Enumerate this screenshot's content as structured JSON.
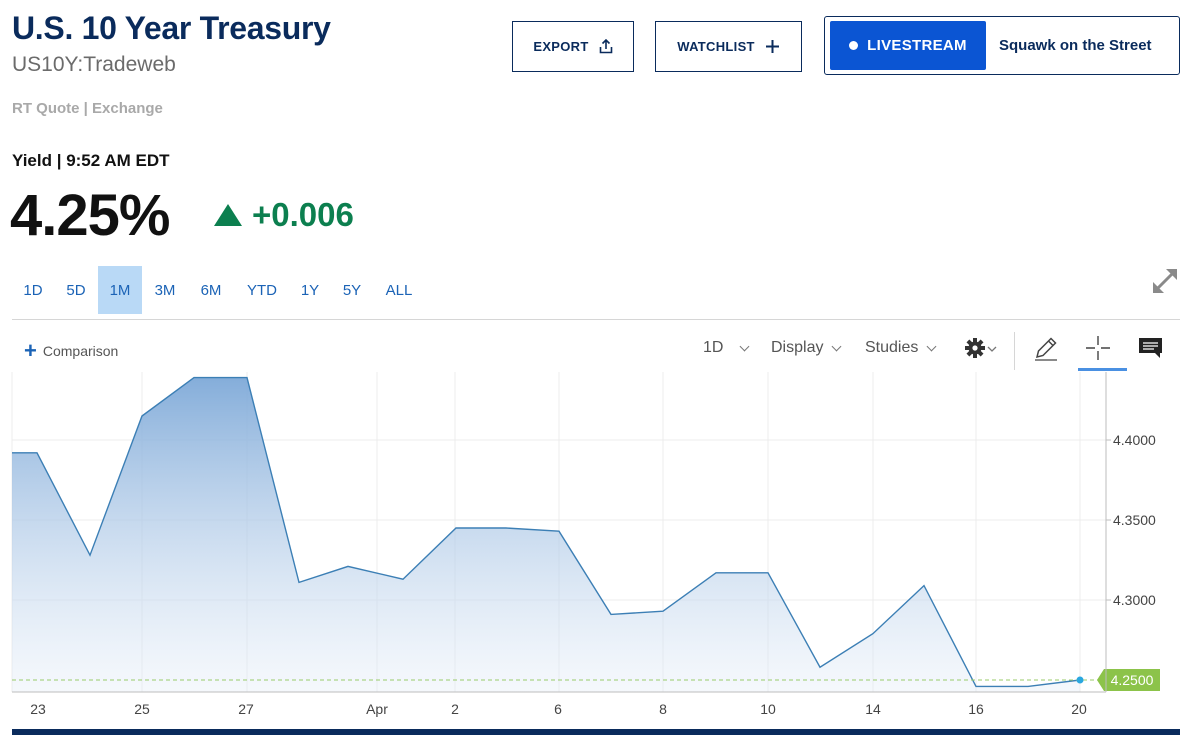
{
  "header": {
    "title": "U.S. 10 Year Treasury",
    "symbol": "US10Y:Tradeweb",
    "quote_source": "RT Quote | Exchange"
  },
  "actions": {
    "export_label": "EXPORT",
    "watchlist_label": "WATCHLIST",
    "livestream_label": "LIVESTREAM",
    "livestream_show": "Squawk on the Street"
  },
  "quote": {
    "label": "Yield | 9:52 AM EDT",
    "price": "4.25%",
    "change": "+0.006",
    "direction": "up"
  },
  "ranges": {
    "items": [
      "1D",
      "5D",
      "1M",
      "3M",
      "6M",
      "YTD",
      "1Y",
      "5Y",
      "ALL"
    ],
    "active": "1M"
  },
  "toolbar": {
    "comparison_label": "Comparison",
    "interval_label": "1D",
    "display_label": "Display",
    "studies_label": "Studies"
  },
  "colors": {
    "brand": "#0a2b5c",
    "accent": "#0b55d3",
    "positive": "#0c7f4f",
    "line": "#3c7fb5",
    "last_tag": "#8cc34a"
  },
  "chart_data": {
    "type": "area",
    "x_ticks": [
      "23",
      "25",
      "27",
      "Apr",
      "2",
      "6",
      "8",
      "10",
      "14",
      "16",
      "20"
    ],
    "y_ticks": [
      "4.4000",
      "4.3500",
      "4.3000"
    ],
    "ylim": [
      4.2425,
      4.4425
    ],
    "grid": true,
    "last_value_label": "4.2500",
    "x": [
      "Mar 23",
      "Mar 24",
      "Mar 25",
      "Mar 26",
      "Mar 27",
      "Mar 28",
      "Mar 30",
      "Mar 31",
      "Apr 2",
      "Apr 3",
      "Apr 6",
      "Apr 7",
      "Apr 8",
      "Apr 9",
      "Apr 10",
      "Apr 13",
      "Apr 14",
      "Apr 15",
      "Apr 16",
      "Apr 17",
      "Apr 20"
    ],
    "series": [
      {
        "values": [
          4.392,
          4.392,
          4.328,
          4.415,
          4.439,
          4.439,
          4.311,
          4.321,
          4.313,
          4.345,
          4.345,
          4.343,
          4.291,
          4.293,
          4.317,
          4.317,
          4.258,
          4.279,
          4.309,
          4.246,
          4.246,
          4.25
        ]
      }
    ]
  }
}
